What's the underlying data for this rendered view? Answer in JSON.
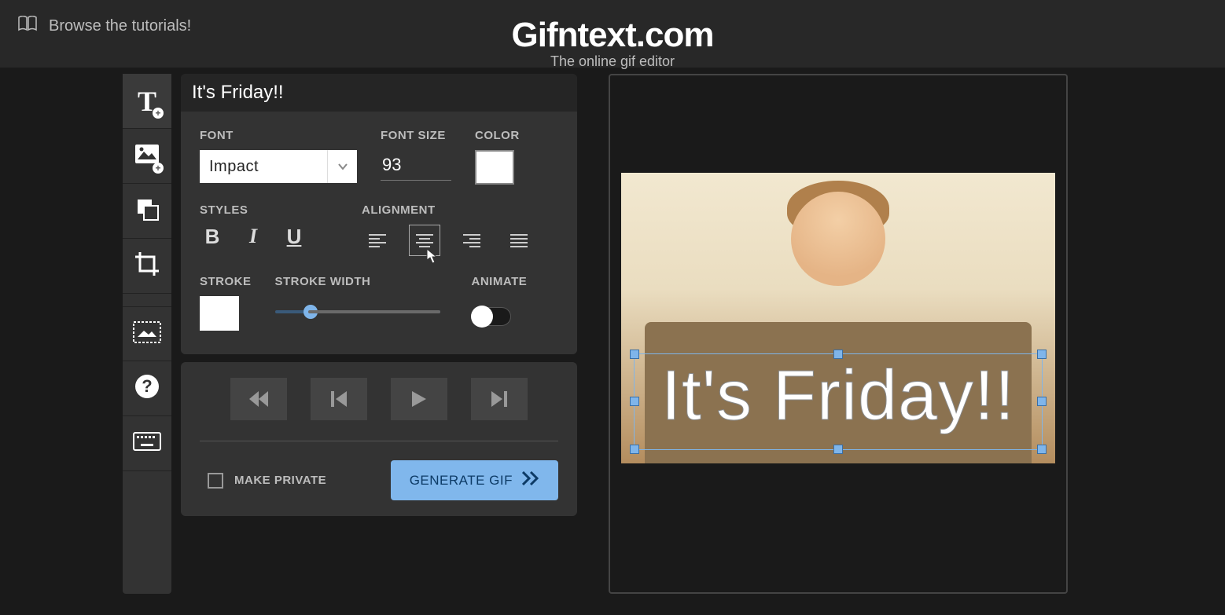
{
  "header": {
    "tutorials_label": "Browse the tutorials!",
    "site_title": "Gifntext.com",
    "site_subtitle": "The online gif editor"
  },
  "toolbar": {
    "items": [
      {
        "name": "add-text",
        "active": true
      },
      {
        "name": "add-image",
        "active": false
      },
      {
        "name": "shape-layer",
        "active": false
      },
      {
        "name": "crop",
        "active": false
      },
      {
        "name": "frame-range",
        "active": false
      },
      {
        "name": "help",
        "active": false
      },
      {
        "name": "keyboard",
        "active": false
      }
    ]
  },
  "text_props": {
    "current_text": "It's Friday!!",
    "labels": {
      "font": "FONT",
      "font_size": "FONT SIZE",
      "color": "COLOR",
      "styles": "STYLES",
      "alignment": "ALIGNMENT",
      "stroke": "STROKE",
      "stroke_width": "STROKE WIDTH",
      "animate": "ANIMATE"
    },
    "font_value": "Impact",
    "font_size_value": "93",
    "color_value": "#ffffff",
    "style_buttons": {
      "bold": "B",
      "italic": "I",
      "underline": "U"
    },
    "alignment_selected": "center",
    "stroke_color": "#ffffff",
    "stroke_width_percent": 18,
    "animate_on": false
  },
  "playback": {
    "buttons": [
      "rewind",
      "step-back",
      "play",
      "step-forward"
    ]
  },
  "export": {
    "make_private_label": "MAKE PRIVATE",
    "make_private_checked": false,
    "generate_label": "GENERATE GIF"
  },
  "canvas": {
    "caption_text": "It's Friday!!"
  }
}
